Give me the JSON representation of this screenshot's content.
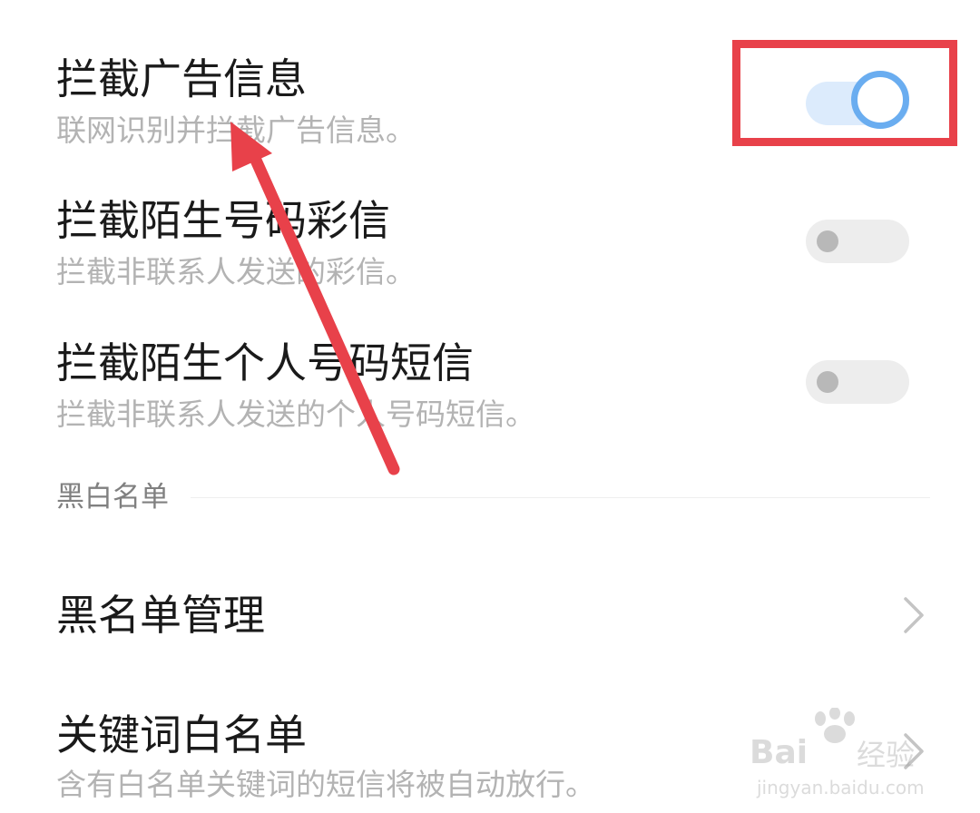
{
  "settings_rows": [
    {
      "title": "拦截广告信息",
      "description": "联网识别并拦截广告信息。",
      "toggle_state": "on"
    },
    {
      "title": "拦截陌生号码彩信",
      "description": "拦截非联系人发送的彩信。",
      "toggle_state": "off"
    },
    {
      "title": "拦截陌生个人号码短信",
      "description": "拦截非联系人发送的个人号码短信。",
      "toggle_state": "off"
    }
  ],
  "blackwhite_section": {
    "header": "黑白名单",
    "items": [
      {
        "title": "黑名单管理"
      },
      {
        "title": "关键词白名单",
        "description": "含有白名单关键词的短信将被自动放行。"
      }
    ]
  },
  "watermark": {
    "brand": "Bai",
    "brand_cn": "经验",
    "url": "jingyan.baidu.com"
  },
  "colors": {
    "toggle_on_track": "#dcebfc",
    "toggle_on_knob_ring": "#6aadf0",
    "toggle_off_track": "#ededed",
    "toggle_off_knob": "#b8b8b8",
    "annotation_red": "#e8414a",
    "title_text": "#1a1a1a",
    "description_text": "#b3b3b3"
  },
  "icons": [
    "toggle-switch",
    "chevron-right-icon",
    "annotation-arrow",
    "baidu-jingyan-watermark"
  ]
}
